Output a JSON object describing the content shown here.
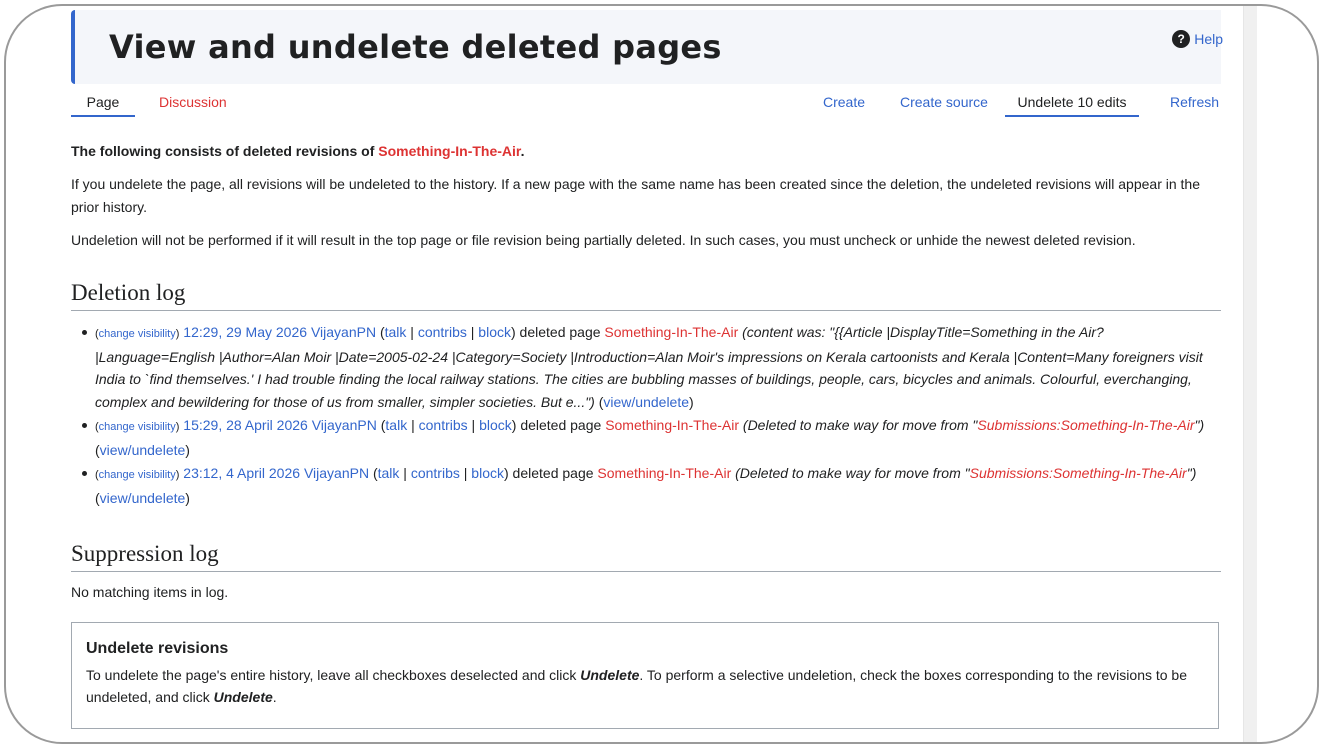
{
  "header": {
    "title": "View and undelete deleted pages",
    "help_label": "Help"
  },
  "tabs": {
    "page": "Page",
    "discussion": "Discussion",
    "create": "Create",
    "create_source": "Create source",
    "undelete": "Undelete 10 edits",
    "refresh": "Refresh"
  },
  "intro": {
    "bold_prefix": "The following consists of deleted revisions of ",
    "page_link": "Something-In-The-Air",
    "bold_suffix": ".",
    "para1": "If you undelete the page, all revisions will be undeleted to the history. If a new page with the same name has been created since the deletion, the undeleted revisions will appear in the prior history.",
    "para2": "Undeletion will not be performed if it will result in the top page or file revision being partially deleted. In such cases, you must uncheck or unhide the newest deleted revision."
  },
  "deletion_log": {
    "heading": "Deletion log",
    "entries": [
      {
        "change_visibility": "change visibility",
        "timestamp": "12:29, 29 May 2026",
        "user": "VijayanPN",
        "talk": "talk",
        "contribs": "contribs",
        "block": "block",
        "action": " deleted page ",
        "page": "Something-In-The-Air",
        "comment_open": " (content was: \"",
        "comment_body": "{{Article |DisplayTitle=Something in the Air? |Language=English |Author=Alan Moir |Date=2005-02-24 |Category=Society |Introduction=Alan Moir's impressions on Kerala cartoonists and Kerala |Content=Many foreigners visit India to `find themselves.' I had trouble finding the local railway stations. The cities are bubbling masses of buildings, people, cars, bicycles and animals. Colourful, everchanging, complex and bewildering for those of us from smaller, simpler societies. But e...\")",
        "view_undelete": "view/undelete"
      },
      {
        "change_visibility": "change visibility",
        "timestamp": "15:29, 28 April 2026",
        "user": "VijayanPN",
        "talk": "talk",
        "contribs": "contribs",
        "block": "block",
        "action": " deleted page ",
        "page": "Something-In-The-Air",
        "comment_open": " (Deleted to make way for move from \"",
        "comment_link": "Submissions:Something-In-The-Air",
        "comment_close": "\")",
        "view_undelete": "view/undelete"
      },
      {
        "change_visibility": "change visibility",
        "timestamp": "23:12, 4 April 2026",
        "user": "VijayanPN",
        "talk": "talk",
        "contribs": "contribs",
        "block": "block",
        "action": " deleted page ",
        "page": "Something-In-The-Air",
        "comment_open": " (Deleted to make way for move from \"",
        "comment_link": "Submissions:Something-In-The-Air",
        "comment_close": "\")",
        "view_undelete": "view/undelete"
      }
    ]
  },
  "suppression_log": {
    "heading": "Suppression log",
    "empty_text": "No matching items in log."
  },
  "undelete_box": {
    "heading": "Undelete revisions",
    "desc_1": "To undelete the page's entire history, leave all checkboxes deselected and click ",
    "undelete_word": "Undelete",
    "desc_2": ". To perform a selective undeletion, check the boxes corresponding to the revisions to be undeleted, and click ",
    "desc_3": "."
  },
  "colors": {
    "link_blue": "#3366cc",
    "link_red": "#dd3333",
    "text": "#202122"
  }
}
